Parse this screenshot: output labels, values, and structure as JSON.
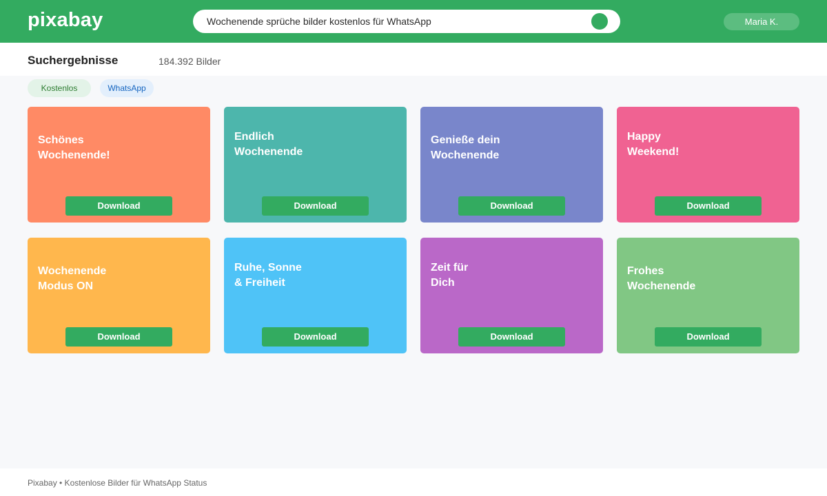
{
  "header": {
    "logo": "pixabay",
    "search_value": "Wochenende sprüche bilder kostenlos für WhatsApp",
    "search_icon": "search-icon",
    "user_name": "Maria K."
  },
  "results": {
    "title": "Suchergebnisse",
    "count": "184.392 Bilder"
  },
  "tags": [
    "Kostenlos",
    "WhatsApp"
  ],
  "cards": [
    {
      "line1": "Schönes",
      "line2": "Wochenende!",
      "color": "#ff8a65",
      "download": "Download"
    },
    {
      "line1": "Endlich",
      "line2": "Wochenende",
      "color": "#4db6ac",
      "download": "Download"
    },
    {
      "line1": "Genieße dein",
      "line2": "Wochenende",
      "color": "#7986cb",
      "download": "Download"
    },
    {
      "line1": "Happy",
      "line2": "Weekend!",
      "color": "#f06292",
      "download": "Download"
    },
    {
      "line1": "Wochenende",
      "line2": "Modus ON",
      "color": "#ffb74d",
      "download": "Download"
    },
    {
      "line1": "Ruhe, Sonne",
      "line2": "& Freiheit",
      "color": "#4fc3f7",
      "download": "Download"
    },
    {
      "line1": "Zeit für",
      "line2": "Dich",
      "color": "#ba68c8",
      "download": "Download"
    },
    {
      "line1": "Frohes",
      "line2": "Wochenende",
      "color": "#81c784",
      "download": "Download"
    }
  ],
  "footer": {
    "text": "Pixabay • Kostenlose Bilder für WhatsApp Status"
  },
  "colors": {
    "brand": "#33ab60",
    "page_background": "#f7f8fa"
  }
}
